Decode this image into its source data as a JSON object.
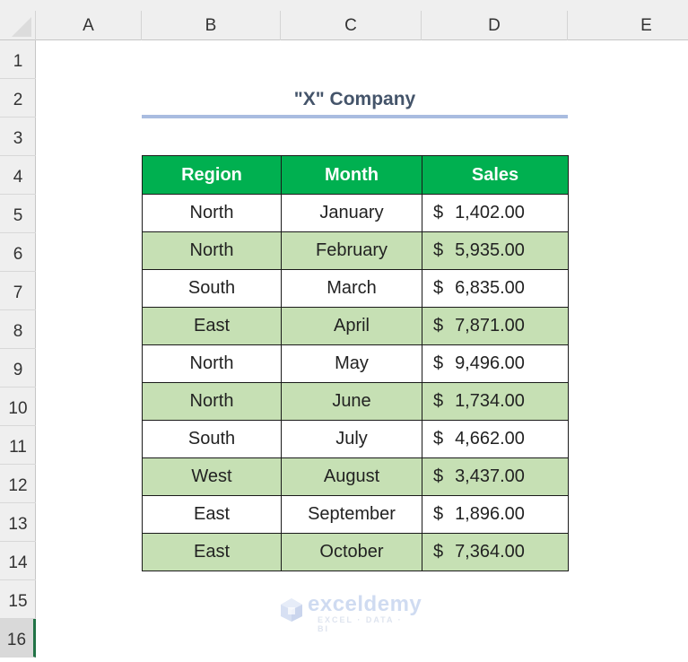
{
  "sheet": {
    "columns": [
      "A",
      "B",
      "C",
      "D",
      "E"
    ],
    "rows": [
      "1",
      "2",
      "3",
      "4",
      "5",
      "6",
      "7",
      "8",
      "9",
      "10",
      "11",
      "12",
      "13",
      "14",
      "15",
      "16"
    ],
    "selected_row": "16"
  },
  "title": "\"X\" Company",
  "table": {
    "headers": [
      "Region",
      "Month",
      "Sales"
    ],
    "currency_symbol": "$",
    "rows": [
      {
        "region": "North",
        "month": "January",
        "sales": "1,402.00"
      },
      {
        "region": "North",
        "month": "February",
        "sales": "5,935.00"
      },
      {
        "region": "South",
        "month": "March",
        "sales": "6,835.00"
      },
      {
        "region": "East",
        "month": "April",
        "sales": "7,871.00"
      },
      {
        "region": "North",
        "month": "May",
        "sales": "9,496.00"
      },
      {
        "region": "North",
        "month": "June",
        "sales": "1,734.00"
      },
      {
        "region": "South",
        "month": "July",
        "sales": "4,662.00"
      },
      {
        "region": "West",
        "month": "August",
        "sales": "3,437.00"
      },
      {
        "region": "East",
        "month": "September",
        "sales": "1,896.00"
      },
      {
        "region": "East",
        "month": "October",
        "sales": "7,364.00"
      }
    ]
  },
  "colors": {
    "header_fill": "#00b050",
    "alt_row_fill": "#c6e0b4",
    "title_color": "#44546a",
    "title_underline": "#a9bce0"
  },
  "watermark": {
    "name": "exceldemy",
    "tagline": "EXCEL · DATA · BI",
    "icon": "exceldemy-logo-icon"
  }
}
